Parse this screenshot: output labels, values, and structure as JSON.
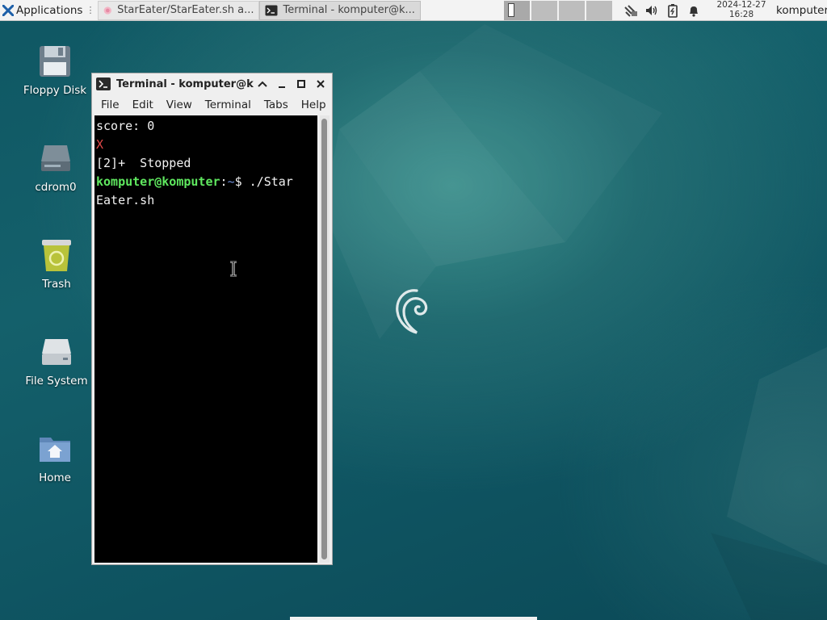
{
  "panel": {
    "applications_label": "Applications",
    "tasks": [
      {
        "label": "StarEater/StarEater.sh a...",
        "icon": "mousepad-icon"
      },
      {
        "label": "Terminal - komputer@k...",
        "icon": "terminal-icon"
      }
    ],
    "workspaces": 4,
    "active_workspace": 1,
    "tray_icons": [
      "network-icon",
      "volume-icon",
      "battery-icon",
      "notification-bell-icon"
    ],
    "clock_date": "2024-12-27",
    "clock_time": "16:28",
    "user": "komputer"
  },
  "desktop_icons": [
    {
      "label": "Floppy Disk",
      "icon": "floppy-disk-icon"
    },
    {
      "label": "cdrom0",
      "icon": "cdrom-drive-icon"
    },
    {
      "label": "Trash",
      "icon": "trash-icon"
    },
    {
      "label": "File System",
      "icon": "hard-drive-icon"
    },
    {
      "label": "Home",
      "icon": "home-folder-icon"
    }
  ],
  "terminal": {
    "title": "Terminal - komputer@komputer: ~",
    "menus": [
      "File",
      "Edit",
      "View",
      "Terminal",
      "Tabs",
      "Help"
    ],
    "lines": {
      "line1": "score: 0",
      "line2": "X",
      "line3": "[2]+  Stopped",
      "prompt_user": "komputer@komputer",
      "prompt_colon": ":",
      "prompt_path": "~",
      "prompt_cmd": "$ ./Star",
      "line5": "Eater.sh"
    }
  },
  "colors": {
    "terminal_bg": "#000000",
    "prompt_green": "#5fe85f",
    "error_red": "#e24a4a",
    "path_blue": "#6d8ed8",
    "desktop_teal": "#14606b"
  }
}
